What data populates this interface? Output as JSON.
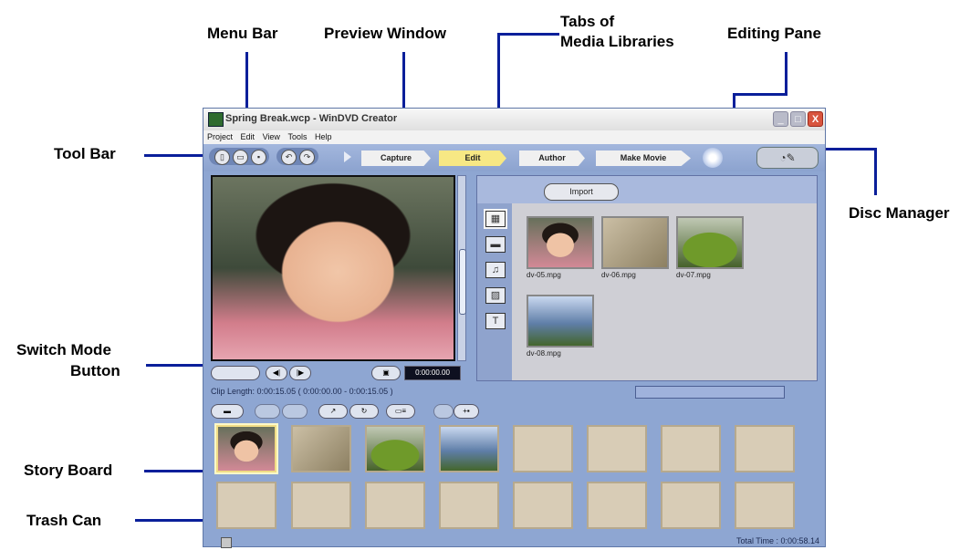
{
  "callouts": {
    "menu_bar": "Menu Bar",
    "preview_window": "Preview Window",
    "tabs_line1": "Tabs of",
    "tabs_line2": "Media Libraries",
    "editing_pane": "Editing Pane",
    "tool_bar": "Tool Bar",
    "disc_manager": "Disc Manager",
    "switch_mode_line1": "Switch Mode",
    "switch_mode_line2": "Button",
    "story_board": "Story Board",
    "trash_can": "Trash Can"
  },
  "window": {
    "title": "Spring Break.wcp - WinDVD Creator",
    "min": "_",
    "max": "□",
    "close": "X"
  },
  "menu": [
    "Project",
    "Edit",
    "View",
    "Tools",
    "Help"
  ],
  "workflow_tabs": [
    {
      "label": "Capture",
      "active": false
    },
    {
      "label": "Edit",
      "active": true
    },
    {
      "label": "Author",
      "active": false
    },
    {
      "label": "Make Movie",
      "active": false
    }
  ],
  "preview": {
    "timecode": "0:00:00.00"
  },
  "library": {
    "import_label": "Import",
    "clips": [
      {
        "name": "dv-05.mpg"
      },
      {
        "name": "dv-06.mpg"
      },
      {
        "name": "dv-07.mpg"
      },
      {
        "name": "dv-08.mpg"
      }
    ]
  },
  "status": {
    "clip_length": "Clip Length: 0:00:15.05 ( 0:00:00.00 - 0:00:15.05 )",
    "total_time": "Total Time : 0:00:58.14"
  },
  "colors": {
    "accent_active_tab": "#f7e884",
    "window_bg": "#8ea6d2",
    "callout_line": "#0a1f9a"
  }
}
